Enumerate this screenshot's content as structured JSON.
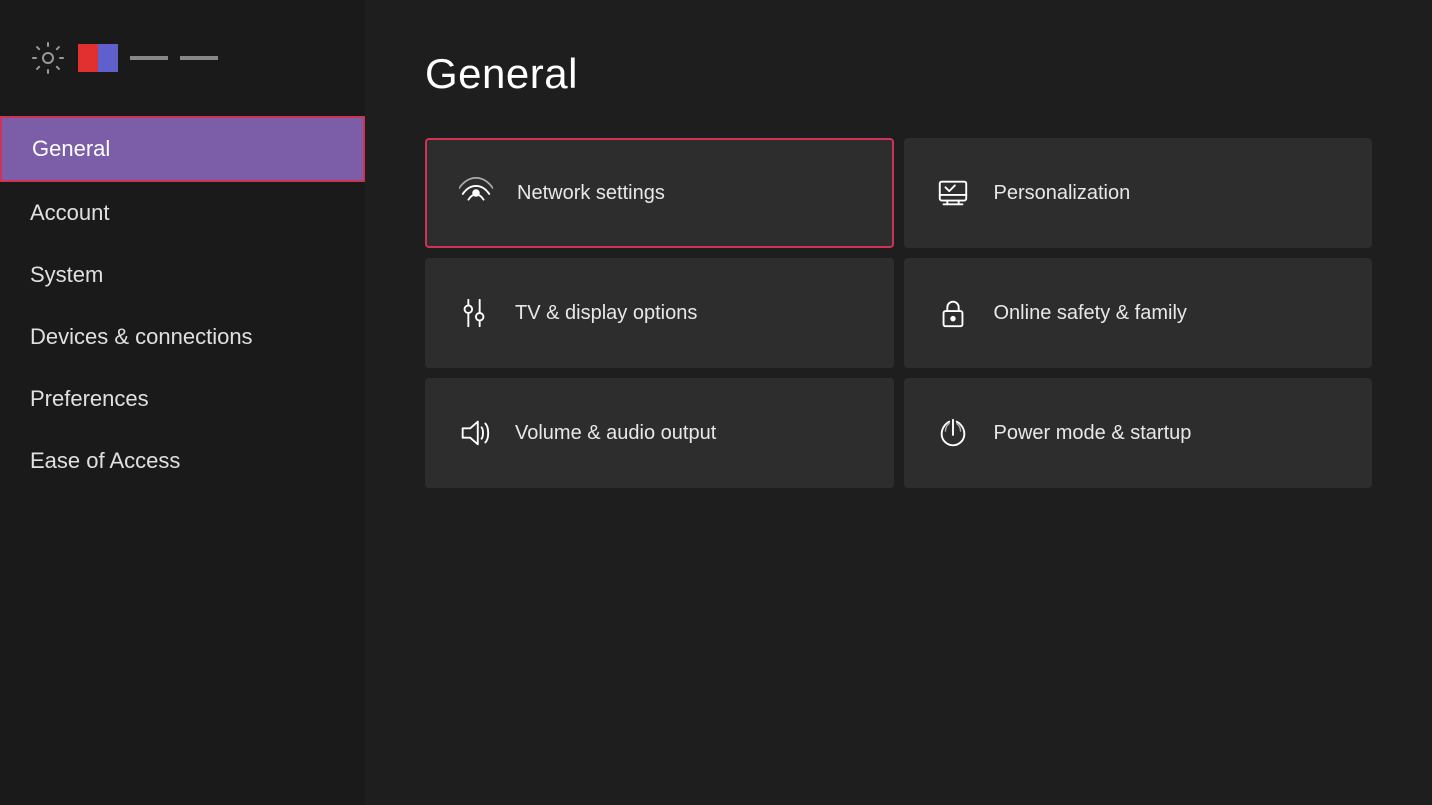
{
  "sidebar": {
    "title": "Settings",
    "nav_items": [
      {
        "id": "general",
        "label": "General",
        "active": true
      },
      {
        "id": "account",
        "label": "Account",
        "active": false
      },
      {
        "id": "system",
        "label": "System",
        "active": false
      },
      {
        "id": "devices",
        "label": "Devices & connections",
        "active": false
      },
      {
        "id": "preferences",
        "label": "Preferences",
        "active": false
      },
      {
        "id": "ease-of-access",
        "label": "Ease of Access",
        "active": false
      }
    ]
  },
  "main": {
    "page_title": "General",
    "cards": [
      {
        "id": "network-settings",
        "label": "Network settings",
        "icon": "network-icon",
        "highlighted": true,
        "col": 1,
        "row": 1
      },
      {
        "id": "personalization",
        "label": "Personalization",
        "icon": "personalization-icon",
        "highlighted": false,
        "col": 2,
        "row": 1
      },
      {
        "id": "tv-display",
        "label": "TV & display options",
        "icon": "tv-icon",
        "highlighted": false,
        "col": 1,
        "row": 2
      },
      {
        "id": "online-safety",
        "label": "Online safety & family",
        "icon": "lock-icon",
        "highlighted": false,
        "col": 2,
        "row": 2
      },
      {
        "id": "volume-audio",
        "label": "Volume & audio output",
        "icon": "volume-icon",
        "highlighted": false,
        "col": 1,
        "row": 3
      },
      {
        "id": "power-mode",
        "label": "Power mode & startup",
        "icon": "power-icon",
        "highlighted": false,
        "col": 2,
        "row": 3
      }
    ]
  },
  "header": {
    "gear_icon": "gear-icon",
    "logo_dash1": "—",
    "logo_dash2": "—"
  }
}
